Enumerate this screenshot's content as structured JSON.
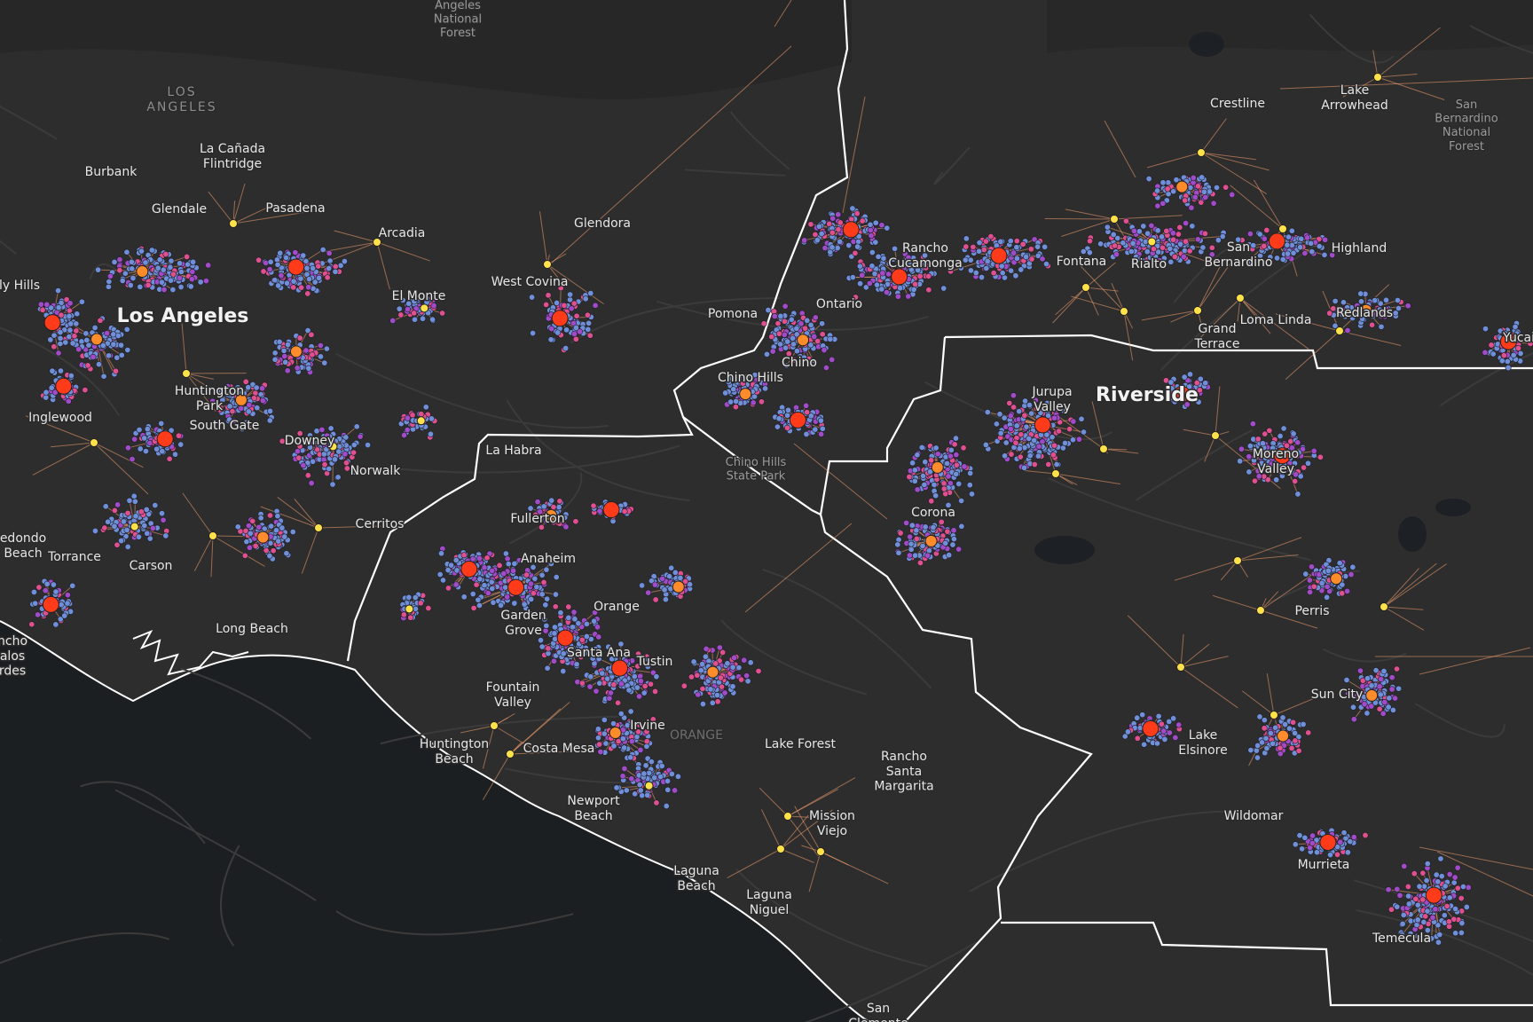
{
  "map": {
    "colors": {
      "land": "#2d2d2d",
      "ocean": "#1c1f22",
      "boundary": "#ffffff",
      "road": "#3a3a3a",
      "edge": "#f4a070",
      "node_blue": "#6f8fd8",
      "node_purple": "#a24bc8",
      "node_pink": "#e0508f",
      "hub_yellow": "#ffe14a",
      "hub_orange": "#ff8c2a",
      "hub_red": "#ff3b1a"
    },
    "labels": {
      "angeles_nf": "Angeles\nNational\nForest",
      "la_county": "LOS\nANGELES",
      "burbank": "Burbank",
      "la_canada": "La Cañada\nFlintridge",
      "glendale": "Glendale",
      "pasadena": "Pasadena",
      "arcadia": "Arcadia",
      "glendora": "Glendora",
      "west_covina": "West Covina",
      "el_monte": "El Monte",
      "los_angeles": "Los Angeles",
      "beverly_hills": "ly Hills",
      "huntington_park": "Huntington\nPark",
      "inglewood": "Inglewood",
      "south_gate": "South Gate",
      "downey": "Downey",
      "norwalk": "Norwalk",
      "la_habra": "La Habra",
      "cerritos": "Cerritos",
      "redondo": "edondo\nBeach",
      "torrance": "Torrance",
      "carson": "Carson",
      "long_beach": "Long Beach",
      "palos_verdes": "ncho\nalos\nrdes",
      "pomona": "Pomona",
      "chino_hills": "Chino Hills",
      "chino": "Chino",
      "chino_hills_sp": "Chino Hills\nState Park",
      "rancho_cucamonga": "Rancho\nCucamonga",
      "ontario": "Ontario",
      "fontana": "Fontana",
      "rialto": "Rialto",
      "san_bernardino": "San\nBernardino",
      "highland": "Highland",
      "crestline": "Crestline",
      "lake_arrowhead": "Lake\nArrowhead",
      "sb_nf": "San\nBernardino\nNational\nForest",
      "grand_terrace": "Grand\nTerrace",
      "loma_linda": "Loma Linda",
      "redlands": "Redlands",
      "yucaipa": "Yucai",
      "riverside": "Riverside",
      "jurupa_valley": "Jurupa\nValley",
      "moreno_valley": "Moreno\nValley",
      "corona": "Corona",
      "fullerton": "Fullerton",
      "anaheim": "Anaheim",
      "garden_grove": "Garden\nGrove",
      "orange": "Orange",
      "santa_ana": "Santa Ana",
      "tustin": "Tustin",
      "fountain_valley": "Fountain\nValley",
      "irvine": "Irvine",
      "orange_county": "ORANGE",
      "huntington_beach": "Huntington\nBeach",
      "costa_mesa": "Costa Mesa",
      "newport_beach": "Newport\nBeach",
      "lake_forest": "Lake Forest",
      "rancho_santa_margarita": "Rancho\nSanta\nMargarita",
      "mission_viejo": "Mission\nViejo",
      "laguna_beach": "Laguna\nBeach",
      "laguna_niguel": "Laguna\nNiguel",
      "san_clemente": "San\nClemente",
      "perris": "Perris",
      "sun_city": "Sun City",
      "lake_elsinore": "Lake\nElsinore",
      "wildomar": "Wildomar",
      "murrieta": "Murrieta",
      "temecula": "Temecula"
    }
  }
}
